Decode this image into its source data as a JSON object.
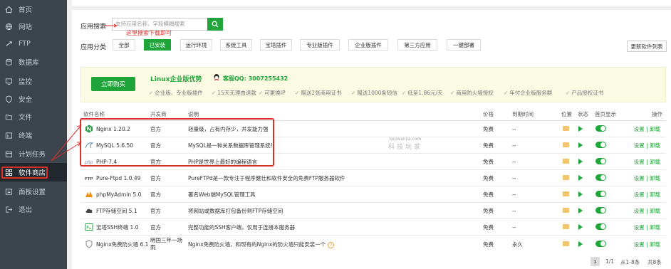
{
  "sidebar": {
    "items": [
      {
        "label": "首页",
        "icon": "home-icon"
      },
      {
        "label": "网站",
        "icon": "globe-icon"
      },
      {
        "label": "FTP",
        "icon": "ftp-icon"
      },
      {
        "label": "数据库",
        "icon": "database-icon"
      },
      {
        "label": "监控",
        "icon": "monitor-icon"
      },
      {
        "label": "安全",
        "icon": "shield-icon"
      },
      {
        "label": "文件",
        "icon": "folder-icon"
      },
      {
        "label": "终端",
        "icon": "terminal-icon"
      },
      {
        "label": "计划任务",
        "icon": "calendar-icon"
      },
      {
        "label": "软件商店",
        "icon": "grid-icon",
        "active": true
      },
      {
        "label": "面板设置",
        "icon": "gear-icon"
      },
      {
        "label": "退出",
        "icon": "logout-icon"
      }
    ]
  },
  "search": {
    "label": "应用搜索",
    "placeholder": "支持应用名称、字段模糊搜索",
    "annotation": "这里搜索下载即可"
  },
  "categories": {
    "label": "应用分类",
    "items": [
      "全部",
      "已安装",
      "运行环境",
      "系统工具",
      "宝塔插件",
      "专业版插件",
      "企业版插件",
      "第三方应用",
      "一键部署"
    ],
    "selected": "已安装",
    "update_label": "更新软件列表"
  },
  "promo": {
    "buy_label": "立即购买",
    "title": "Linux企业版优势",
    "qq": "客服QQ: 3007255432",
    "features": [
      "企业版、专业版插件",
      "15天无理由退款",
      "可更换IP",
      "赠送2张商用证书",
      "赠送1000条短信",
      "低至1.86元/天",
      "商用防火墙授权",
      "年付企业版服务群",
      "产品授权证书"
    ]
  },
  "table": {
    "headers": {
      "name": "软件名称",
      "dev": "开发商",
      "desc": "说明",
      "price": "价格",
      "expire": "到期时间",
      "location": "位置",
      "status": "状态",
      "home": "首页显示",
      "ops": "操作"
    },
    "rows": [
      {
        "name": "Nginx 1.20.2",
        "icon": "nginx-icon",
        "dev": "官方",
        "desc": "轻量级，占有内存少，并发能力强",
        "price": "免费",
        "expire": "--",
        "ops": "设置 | 卸载"
      },
      {
        "name": "MySQL 5.6.50",
        "icon": "mysql-icon",
        "dev": "官方",
        "desc": "MySQL是一种关系数据库管理系统!",
        "price": "免费",
        "expire": "--",
        "ops": "设置 | 卸载"
      },
      {
        "name": "PHP-7.4",
        "icon": "php-icon",
        "dev": "官方",
        "desc": "PHP是世界上最好的编程语言",
        "price": "免费",
        "expire": "--",
        "ops": "设置 | 卸载"
      },
      {
        "name": "Pure-Ftpd 1.0.49",
        "icon": "ftpd-icon",
        "dev": "官方",
        "desc": "PureFTPd是一款专注于程序健壮和软件安全的免费FTP服务器软件",
        "price": "免费",
        "expire": "--",
        "ops": "设置 | 卸载"
      },
      {
        "name": "phpMyAdmin 5.0",
        "icon": "phpmyadmin-icon",
        "dev": "官方",
        "desc": "著名Web端MySQL管理工具",
        "price": "免费",
        "expire": "--",
        "ops": "设置 | 卸载"
      },
      {
        "name": "FTP存储空间 5.1",
        "icon": "cloud-icon",
        "dev": "官方",
        "desc": "将网站或数据库打包备份到FTP存储空间",
        "price": "免费",
        "expire": "--",
        "ops": "设置 | 卸载"
      },
      {
        "name": "宝塔SSH终端 1.0",
        "icon": "ssh-icon",
        "dev": "官方",
        "desc": "完整功能的SSH客户端，仅用于连接本服务器",
        "price": "免费",
        "expire": "--",
        "ops": "设置 | 卸载"
      },
      {
        "name": "Nginx免费防火墙 6.1",
        "icon": "firewall-icon",
        "dev": "明国三年一场雨",
        "desc": "Nginx免费防火墙，和现有的Nginx的防火墙只能安装一个",
        "price": "免费",
        "expire": "永久",
        "ops": "设置 | 卸载"
      }
    ]
  },
  "watermark": {
    "small": "kejiwanjia.com",
    "big": "科技玩家"
  },
  "pagination": {
    "page": "1",
    "pages": "1/1",
    "range": "从1-8条",
    "total": "共8条"
  },
  "colors": {
    "accent": "#20a53a",
    "sidebar": "#3c444d",
    "annotation": "#d9302c"
  }
}
